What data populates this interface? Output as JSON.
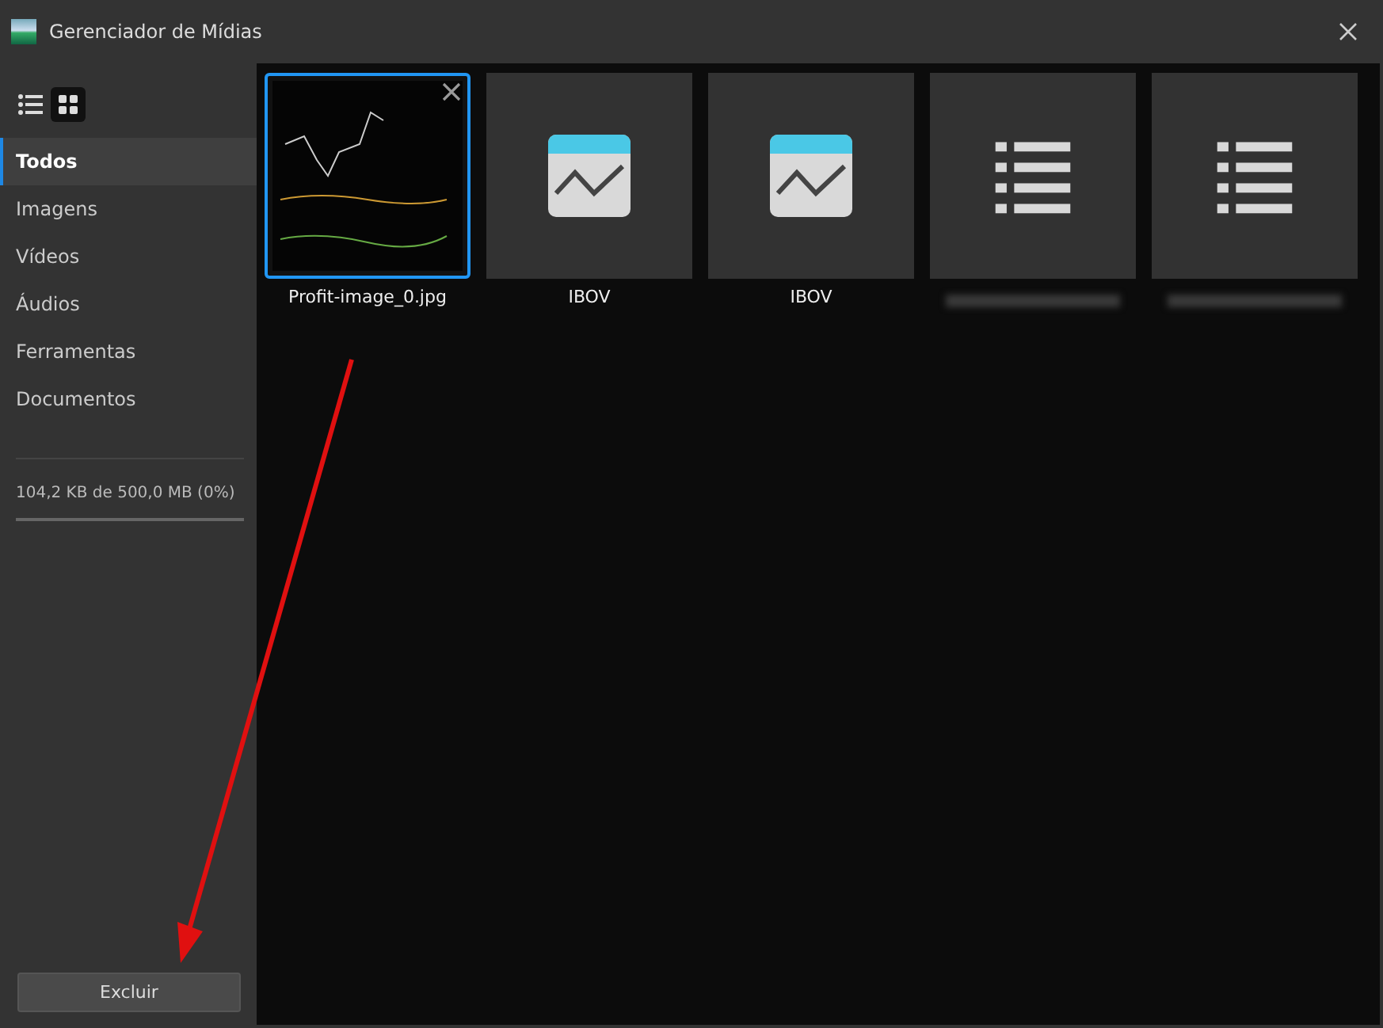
{
  "window": {
    "title": "Gerenciador de Mídias"
  },
  "view_toggle": [
    {
      "kind": "list",
      "selected": false
    },
    {
      "kind": "grid",
      "selected": true
    }
  ],
  "sidebar": {
    "items": [
      {
        "label": "Todos",
        "selected": true
      },
      {
        "label": "Imagens",
        "selected": false
      },
      {
        "label": "Vídeos",
        "selected": false
      },
      {
        "label": "Áudios",
        "selected": false
      },
      {
        "label": "Ferramentas",
        "selected": false
      },
      {
        "label": "Documentos",
        "selected": false
      }
    ]
  },
  "storage": {
    "text": "104,2 KB de 500,0 MB (0%)",
    "level": 0
  },
  "delete_button": "Excluir",
  "media": [
    {
      "kind": "image",
      "label": "Profit-image_0.jpg",
      "selected": true
    },
    {
      "kind": "chart",
      "label": "IBOV",
      "selected": false
    },
    {
      "kind": "chart",
      "label": "IBOV",
      "selected": false
    },
    {
      "kind": "list",
      "selected": false
    },
    {
      "kind": "list",
      "selected": false
    }
  ]
}
